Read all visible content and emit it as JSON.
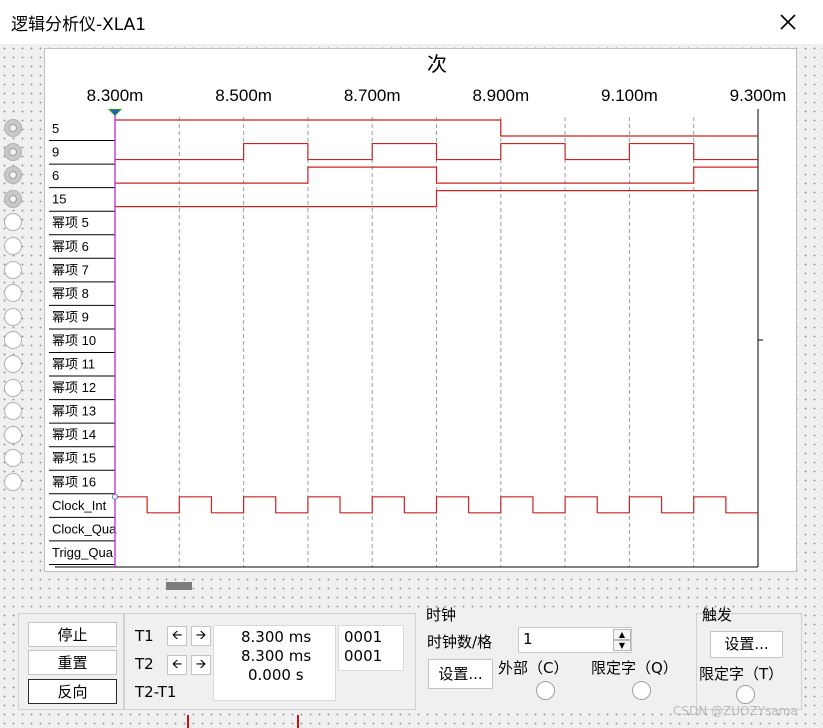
{
  "window": {
    "title": "逻辑分析仪-XLA1"
  },
  "display": {
    "top_label": "次",
    "time_ticks": [
      {
        "label": "8.300m",
        "t": 8.3
      },
      {
        "label": "8.500m",
        "t": 8.5
      },
      {
        "label": "8.700m",
        "t": 8.7
      },
      {
        "label": "8.900m",
        "t": 8.9
      },
      {
        "label": "9.100m",
        "t": 9.1
      },
      {
        "label": "9.300m",
        "t": 9.3
      }
    ],
    "time_range_ms": [
      8.3,
      9.3
    ],
    "grid_dashed": true,
    "trace_color": "#cc2222",
    "cursor_color": "#c026d3",
    "channels": [
      "5",
      "9",
      "6",
      "15",
      "幂项 5",
      "幂项 6",
      "幂项 7",
      "幂项 8",
      "幂项 9",
      "幂项 10",
      "幂项 11",
      "幂项 12",
      "幂项 13",
      "幂项 14",
      "幂项 15",
      "幂项 16"
    ],
    "active_channels": 4,
    "clock_labels": [
      "Clock_Int",
      "Clock_Qua",
      "Trigg_Qua"
    ],
    "waveforms": [
      {
        "start": 1,
        "transitions_ms": [
          8.9
        ]
      },
      {
        "start": 0,
        "transitions_ms": [
          8.5,
          8.6,
          8.7,
          8.8,
          8.9,
          9.0,
          9.1,
          9.2
        ]
      },
      {
        "start": 0,
        "transitions_ms": [
          8.6,
          8.8,
          9.2
        ]
      },
      {
        "start": 0,
        "transitions_ms": [
          8.8
        ]
      }
    ],
    "clock": {
      "high_ms": 0.05,
      "period_ms": 0.1
    }
  },
  "controls": {
    "stop": "停止",
    "reset": "重置",
    "reverse": "反向",
    "t1_label": "T1",
    "t2_label": "T2",
    "t2t1_label": "T2-T1",
    "t1_time": "8.300 ms",
    "t2_time": "8.300 ms",
    "diff_time": "0.000 s",
    "t1_value": "0001",
    "t2_value": "0001",
    "clock_title": "时钟",
    "clocks_per_div_label": "时钟数/格",
    "clocks_per_div": "1",
    "clock_setup": "设置...",
    "external_label": "外部（C）",
    "qualifier_label": "限定字（Q）",
    "trigger_title": "触发",
    "trigger_setup": "设置...",
    "trigger_qualifier_label": "限定字（T）"
  },
  "watermark": "CSDN @ZUOZYsama"
}
